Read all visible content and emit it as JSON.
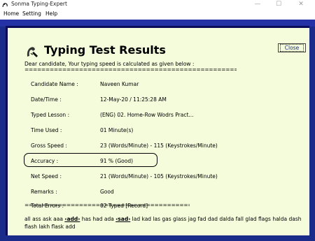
{
  "window": {
    "title": "Sonma Typing-Expert",
    "controls": {
      "minimize": "—",
      "maximize": "☐",
      "close": "✕"
    }
  },
  "menu": {
    "items": [
      "Home",
      "Setting",
      "Help"
    ]
  },
  "dialog": {
    "title": "Typing Test Results",
    "close_label": "Close",
    "intro": "Dear candidate, Your typing speed is calculated as given below :",
    "rule_top": "================================================================",
    "rule_bottom": "================================================",
    "rows": [
      {
        "label": "Candidate Name :",
        "value": "Naveen Kumar"
      },
      {
        "label": "Date/Time :",
        "value": "12-May-20 / 11:25:28 AM"
      },
      {
        "label": "Typed Lesson :",
        "value": "(ENG) 02. Home-Row Wodrs Pract..."
      },
      {
        "label": "Time Used :",
        "value": "01 Minute(s)"
      },
      {
        "label": "Gross Speed :",
        "value": "23 (Words/Minute)  -  115 (Keystrokes/Minute)"
      },
      {
        "label": "Accuracy :",
        "value": "91 % (Good)"
      },
      {
        "label": "Net Speed :",
        "value": "21 (Words/Minute)  -  105 (Keystrokes/Minute)"
      },
      {
        "label": "Remarks :",
        "value": "Good"
      },
      {
        "label": "Total Errors :",
        "value": "02 Typed [Record]"
      }
    ],
    "lesson": {
      "part1": "all ass ask aaa ",
      "error1": "‹add›",
      "part2": " has had ada ",
      "error2": "‹sad›",
      "part3": " lad kad las gas glass jag fad dad dalda fall glad flags halda dash flash lakh flask add"
    }
  },
  "colors": {
    "frame": "#1a2b8a",
    "panel": "#f4fcdc"
  }
}
